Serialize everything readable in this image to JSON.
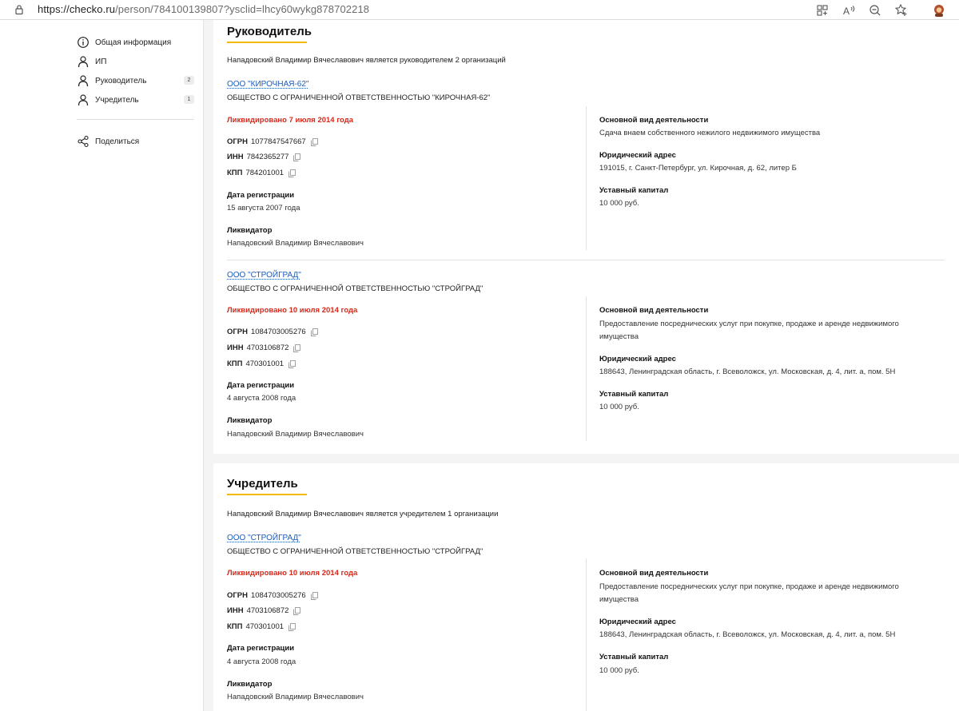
{
  "browser": {
    "url_main": "https://checko.ru",
    "url_rest": "/person/784100139807?ysclid=lhcy60wykg878702218"
  },
  "sidebar": {
    "items": [
      {
        "label": "Общая информация",
        "icon": "info-icon",
        "badge": ""
      },
      {
        "label": "ИП",
        "icon": "person-icon",
        "badge": ""
      },
      {
        "label": "Руководитель",
        "icon": "person-icon",
        "badge": "2"
      },
      {
        "label": "Учредитель",
        "icon": "person-icon",
        "badge": "1"
      }
    ],
    "share_label": "Поделиться"
  },
  "sections": [
    {
      "title": "Руководитель",
      "summary": "Нападовский Владимир Вячеславович является руководителем 2 организаций",
      "orgs": [
        {
          "short_name": "ООО \"КИРОЧНАЯ-62\"",
          "full_name": "ОБЩЕСТВО С ОГРАНИЧЕННОЙ ОТВЕТСТВЕННОСТЬЮ \"КИРОЧНАЯ-62\"",
          "status": "Ликвидировано 7 июля 2014 года",
          "ogrn_label": "ОГРН",
          "ogrn": "1077847547667",
          "inn_label": "ИНН",
          "inn": "7842365277",
          "kpp_label": "КПП",
          "kpp": "784201001",
          "reg_label": "Дата регистрации",
          "reg_date": "15 августа 2007 года",
          "liq_label": "Ликвидатор",
          "liquidator": "Нападовский Владимир Вячеславович",
          "activity_label": "Основной вид деятельности",
          "activity": "Сдача внаем собственного нежилого недвижимого имущества",
          "address_label": "Юридический адрес",
          "address": "191015, г. Санкт-Петербург, ул. Кирочная, д. 62, литер Б",
          "capital_label": "Уставный капитал",
          "capital": "10 000 руб."
        },
        {
          "short_name": "ООО \"СТРОЙГРАД\"",
          "full_name": "ОБЩЕСТВО С ОГРАНИЧЕННОЙ ОТВЕТСТВЕННОСТЬЮ \"СТРОЙГРАД\"",
          "status": "Ликвидировано 10 июля 2014 года",
          "ogrn_label": "ОГРН",
          "ogrn": "1084703005276",
          "inn_label": "ИНН",
          "inn": "4703106872",
          "kpp_label": "КПП",
          "kpp": "470301001",
          "reg_label": "Дата регистрации",
          "reg_date": "4 августа 2008 года",
          "liq_label": "Ликвидатор",
          "liquidator": "Нападовский Владимир Вячеславович",
          "activity_label": "Основной вид деятельности",
          "activity_1": "Предоставление посреднических услуг при покупке, продаже и аренде недвижимого",
          "activity_2": "имущества",
          "address_label": "Юридический адрес",
          "address": "188643, Ленинградская область, г. Всеволожск, ул. Московская, д. 4, лит. а, пом. 5Н",
          "capital_label": "Уставный капитал",
          "capital": "10 000 руб."
        }
      ]
    },
    {
      "title": "Учредитель",
      "summary": "Нападовский Владимир Вячеславович является учредителем 1 организации",
      "orgs": [
        {
          "short_name": "ООО \"СТРОЙГРАД\"",
          "full_name": "ОБЩЕСТВО С ОГРАНИЧЕННОЙ ОТВЕТСТВЕННОСТЬЮ \"СТРОЙГРАД\"",
          "status": "Ликвидировано 10 июля 2014 года",
          "ogrn_label": "ОГРН",
          "ogrn": "1084703005276",
          "inn_label": "ИНН",
          "inn": "4703106872",
          "kpp_label": "КПП",
          "kpp": "470301001",
          "reg_label": "Дата регистрации",
          "reg_date": "4 августа 2008 года",
          "liq_label": "Ликвидатор",
          "liquidator": "Нападовский Владимир Вячеславович",
          "activity_label": "Основной вид деятельности",
          "activity_1": "Предоставление посреднических услуг при покупке, продаже и аренде недвижимого",
          "activity_2": "имущества",
          "address_label": "Юридический адрес",
          "address": "188643, Ленинградская область, г. Всеволожск, ул. Московская, д. 4, лит. а, пом. 5Н",
          "capital_label": "Уставный капитал",
          "capital": "10 000 руб."
        }
      ]
    }
  ],
  "colors": {
    "link": "#1a5bb8",
    "status_red": "#d9281a",
    "accent_underline": "#f5b800"
  }
}
